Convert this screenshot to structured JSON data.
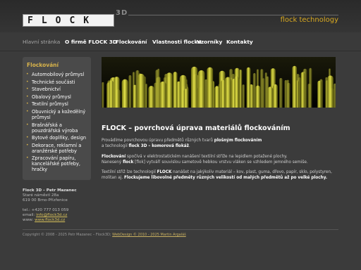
{
  "header": {
    "logo_text": "FLOCK",
    "logo_suffix": "3D",
    "tagline": "flock technology"
  },
  "nav": {
    "items": [
      {
        "label": "Hlavní stránka",
        "active": true
      },
      {
        "label": "O firmě FLOCK 3D"
      },
      {
        "label": "Flockování"
      },
      {
        "label": "Vlastnosti flocku"
      },
      {
        "label": "Vzorníky"
      },
      {
        "label": "Kontakty"
      }
    ]
  },
  "sidebar": {
    "title": "Flockování",
    "items": [
      {
        "label": "Automobilový průmysl"
      },
      {
        "label": "Technické součásti"
      },
      {
        "label": "Stavebnictví"
      },
      {
        "label": "Obalový průmysl"
      },
      {
        "label": "Textilní průmysl"
      },
      {
        "label": "Obuvnický a kožedělný průmysl"
      },
      {
        "label": "Brašnářská a pouzdrářská výroba"
      },
      {
        "label": "Bytové doplňky, design"
      },
      {
        "label": "Dekorace, reklamní a aranžérské potřeby"
      },
      {
        "label": "Zpracování papíru, kancelářské potřeby, hračky"
      }
    ]
  },
  "contact": {
    "name": "Flock 3D – Petr Mazanec",
    "street": "Staré náměstí 28a",
    "city": "619 00 Brno-Přízřenice",
    "phone": "tel.: +420 777 013 059",
    "email_label": "email:",
    "email": "info@flock3d.cz",
    "web_label": "www:",
    "web": "www.flock3d.cz"
  },
  "content": {
    "title": "FLOCK – povrchová úprava materiálů flockováním",
    "p1_a": "Provádíme povrchovou úpravu předmětů různých tvarů ",
    "p1_b": "plošným flockováním",
    "p1_c": "a technologií ",
    "p1_d": "flock 3D – komorová flokáž",
    "p1_e": ".",
    "p2_a": "Flockování",
    "p2_b": " spočívá v elektrostatickém nanášení textilní střiže na lepidlem potažené plochy.",
    "p2_c": "Nanesený ",
    "p2_d": "flock",
    "p2_e": " [flok] vytváří souvislou sametově hebkou vrstvu vláken se vzhledem jemného semiše.",
    "p3_a": "Textilní střiž lze technologií ",
    "p3_b": "FLOCK",
    "p3_c": " nanášet na jakýkoliv materiál – kov, plast, guma, dřevo, papír, sklo, polystyren,",
    "p3_d": "molitan aj. ",
    "p3_e": "Flockujeme libovolné předměty různých velikostí od malých předmětů až po velké plochy."
  },
  "footer": {
    "text": "Copyright © 2008 - 2025 Petr Mazanec – Flock3D;",
    "link_label": "WebDesign © 2010 - 2025 Martin Argaláš"
  },
  "colors": {
    "background": "#3b3b3b",
    "accent": "#d9b44a",
    "tagline": "#d9a920"
  }
}
